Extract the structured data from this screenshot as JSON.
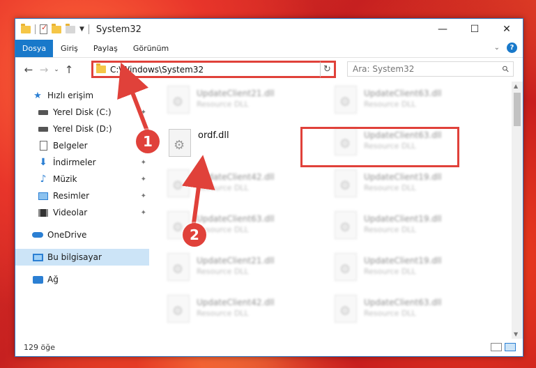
{
  "window": {
    "title": "System32",
    "controls": {
      "minimize": "—",
      "maximize": "☐",
      "close": "✕"
    }
  },
  "ribbon": {
    "tabs": [
      "Dosya",
      "Giriş",
      "Paylaş",
      "Görünüm"
    ],
    "help": "?"
  },
  "nav": {
    "address": "C:\\Windows\\System32",
    "search_placeholder": "Ara: System32"
  },
  "sidebar": {
    "items": [
      {
        "label": "Hızlı erişim",
        "icon": "star-icon"
      },
      {
        "label": "Yerel Disk (C:)",
        "icon": "drive-icon"
      },
      {
        "label": "Yerel Disk (D:)",
        "icon": "drive-icon"
      },
      {
        "label": "Belgeler",
        "icon": "document-icon"
      },
      {
        "label": "İndirmeler",
        "icon": "download-icon"
      },
      {
        "label": "Müzik",
        "icon": "music-icon"
      },
      {
        "label": "Resimler",
        "icon": "picture-icon"
      },
      {
        "label": "Videolar",
        "icon": "video-icon"
      },
      {
        "label": "OneDrive",
        "icon": "cloud-icon"
      },
      {
        "label": "Bu bilgisayar",
        "icon": "computer-icon"
      },
      {
        "label": "Ağ",
        "icon": "network-icon"
      }
    ]
  },
  "files": {
    "left": [
      {
        "name": "UpdateClient21.dll",
        "type": "Resource DLL"
      },
      {
        "name": "ordf.dll",
        "type": ""
      },
      {
        "name": "UpdateClient42.dll",
        "type": "Resource DLL"
      },
      {
        "name": "UpdateClient63.dll",
        "type": "Resource DLL"
      },
      {
        "name": "UpdateClient21.dll",
        "type": "Resource DLL"
      },
      {
        "name": "UpdateClient42.dll",
        "type": "Resource DLL"
      }
    ],
    "right": [
      {
        "name": "UpdateClient63.dll",
        "type": "Resource DLL"
      },
      {
        "name": "UpdateClient63.dll",
        "type": "Resource DLL"
      },
      {
        "name": "UpdateClient19.dll",
        "type": "Resource DLL"
      },
      {
        "name": "UpdateClient19.dll",
        "type": "Resource DLL"
      },
      {
        "name": "UpdateClient19.dll",
        "type": "Resource DLL"
      },
      {
        "name": "UpdateClient63.dll",
        "type": "Resource DLL"
      }
    ]
  },
  "status": {
    "count": "129 öğe"
  },
  "callouts": [
    "1",
    "2"
  ],
  "colors": {
    "accent": "#1979ca",
    "highlight": "#e0413a",
    "selected": "#cce4f7"
  }
}
